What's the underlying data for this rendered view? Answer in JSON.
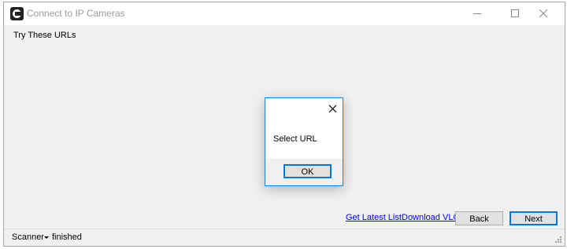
{
  "window": {
    "title": "Connect to IP Cameras"
  },
  "main": {
    "heading": "Try These URLs",
    "links": {
      "latest": "Get Latest List",
      "vlc": "Download VLC"
    },
    "buttons": {
      "back": "Back",
      "next": "Next"
    }
  },
  "statusbar": {
    "dropdown_label": "Scanner",
    "status": "finished"
  },
  "dialog": {
    "message": "Select URL",
    "ok_label": "OK"
  },
  "colors": {
    "accent": "#0078d7",
    "link": "#0000ee"
  }
}
